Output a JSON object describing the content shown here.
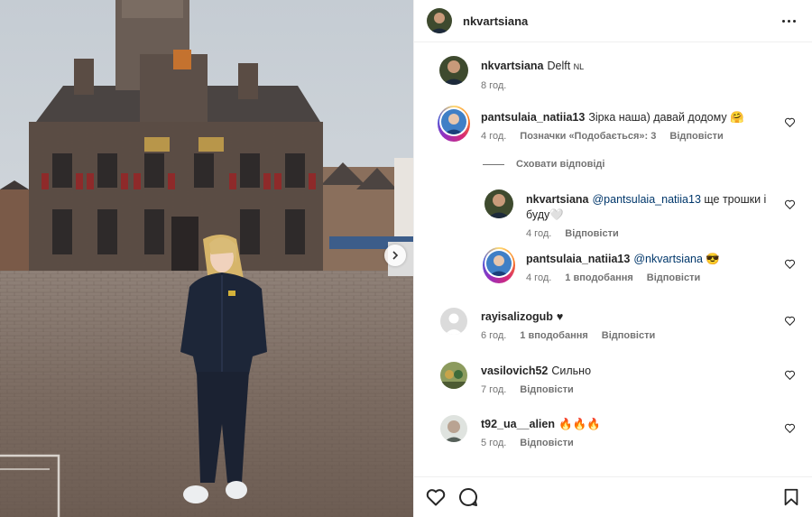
{
  "post": {
    "author": "nkvartsiana"
  },
  "caption": {
    "user": "nkvartsiana",
    "text": "Delft",
    "country": "NL",
    "time": "8 год."
  },
  "comments": [
    {
      "user": "pantsulaia_natiia13",
      "text": "Зірка наша) давай додому 🤗",
      "time": "4 год.",
      "likes": "Позначки «Подобається»: 3",
      "reply": "Відповісти"
    },
    {
      "hide_replies": "Сховати відповіді"
    },
    {
      "user": "nkvartsiana",
      "mention": "@pantsulaia_natiia13",
      "text": " ще трошки і буду🤍",
      "time": "4 год.",
      "reply": "Відповісти"
    },
    {
      "user": "pantsulaia_natiia13",
      "mention": "@nkvartsiana",
      "text": " 😎",
      "time": "4 год.",
      "likes": "1 вподобання",
      "reply": "Відповісти"
    },
    {
      "user": "rayisalizogub",
      "text": "♥",
      "time": "6 год.",
      "likes": "1 вподобання",
      "reply": "Відповісти"
    },
    {
      "user": "vasilovich52",
      "text": "Сильно",
      "time": "7 год.",
      "reply": "Відповісти"
    },
    {
      "user": "t92_ua__alien",
      "text": "🔥🔥🔥",
      "time": "5 год.",
      "reply": "Відповісти"
    }
  ],
  "icons": {
    "like": "heart-icon",
    "comment": "comment-icon",
    "save": "bookmark-icon",
    "more": "more-options-icon",
    "next": "chevron-right-icon"
  }
}
